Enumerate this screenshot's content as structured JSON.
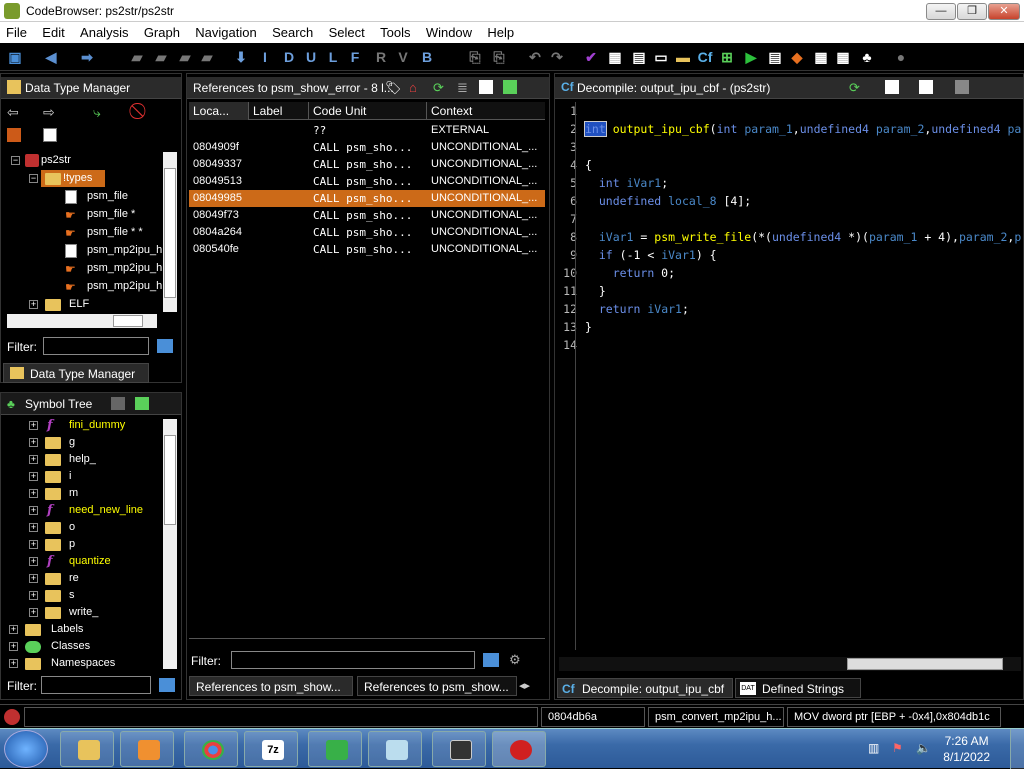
{
  "window": {
    "title": "CodeBrowser: ps2str/ps2str",
    "minimize": "—",
    "maximize": "❐",
    "close": "✕"
  },
  "menu": [
    "File",
    "Edit",
    "Analysis",
    "Graph",
    "Navigation",
    "Search",
    "Select",
    "Tools",
    "Window",
    "Help"
  ],
  "toolbar": {
    "letters": [
      "I",
      "D",
      "U",
      "L",
      "F",
      "V",
      "B"
    ]
  },
  "data_type_manager": {
    "title": "Data Type Manager",
    "tree": [
      {
        "label": "ps2str",
        "kind": "root"
      },
      {
        "label": "!types",
        "kind": "folder-open",
        "selected": true
      },
      {
        "label": "psm_file",
        "kind": "struct"
      },
      {
        "label": "psm_file *",
        "kind": "ptr"
      },
      {
        "label": "psm_file * *",
        "kind": "ptr"
      },
      {
        "label": "psm_mp2ipu_h",
        "kind": "struct"
      },
      {
        "label": "psm_mp2ipu_h",
        "kind": "ptr"
      },
      {
        "label": "psm_mp2ipu_h",
        "kind": "ptr"
      },
      {
        "label": "ELF",
        "kind": "folder"
      }
    ],
    "filter_label": "Filter:",
    "tab_label": "Data Type Manager"
  },
  "symbol_tree": {
    "title": "Symbol Tree",
    "items": [
      {
        "label": "fini_dummy",
        "kind": "func"
      },
      {
        "label": "g",
        "kind": "folder"
      },
      {
        "label": "help_",
        "kind": "folder"
      },
      {
        "label": "i",
        "kind": "folder"
      },
      {
        "label": "m",
        "kind": "folder"
      },
      {
        "label": "need_new_line",
        "kind": "func"
      },
      {
        "label": "o",
        "kind": "folder"
      },
      {
        "label": "p",
        "kind": "folder"
      },
      {
        "label": "quantize",
        "kind": "func"
      },
      {
        "label": "re",
        "kind": "folder"
      },
      {
        "label": "s",
        "kind": "folder"
      },
      {
        "label": "write_",
        "kind": "folder"
      },
      {
        "label": "Labels",
        "kind": "top"
      },
      {
        "label": "Classes",
        "kind": "top"
      },
      {
        "label": "Namespaces",
        "kind": "top"
      }
    ],
    "filter_label": "Filter:"
  },
  "references": {
    "title": "References to psm_show_error - 8 l...",
    "columns": [
      "Loca...",
      "Label",
      "Code Unit",
      "Context"
    ],
    "rows": [
      {
        "loc": "",
        "label": "",
        "code": "??",
        "ctx": "EXTERNAL",
        "selected": false
      },
      {
        "loc": "0804909f",
        "label": "",
        "code": "CALL psm_sho...",
        "ctx": "UNCONDITIONAL_...",
        "selected": false
      },
      {
        "loc": "08049337",
        "label": "",
        "code": "CALL psm_sho...",
        "ctx": "UNCONDITIONAL_...",
        "selected": false
      },
      {
        "loc": "08049513",
        "label": "",
        "code": "CALL psm_sho...",
        "ctx": "UNCONDITIONAL_...",
        "selected": false
      },
      {
        "loc": "08049985",
        "label": "",
        "code": "CALL psm_sho...",
        "ctx": "UNCONDITIONAL_...",
        "selected": true
      },
      {
        "loc": "08049f73",
        "label": "",
        "code": "CALL psm_sho...",
        "ctx": "UNCONDITIONAL_...",
        "selected": false
      },
      {
        "loc": "0804a264",
        "label": "",
        "code": "CALL psm_sho...",
        "ctx": "UNCONDITIONAL_...",
        "selected": false
      },
      {
        "loc": "080540fe",
        "label": "",
        "code": "CALL psm_sho...",
        "ctx": "UNCONDITIONAL_...",
        "selected": false
      }
    ],
    "filter_label": "Filter:",
    "tabs": [
      "References to psm_show...",
      "References to psm_show..."
    ]
  },
  "decompile": {
    "title": "Decompile: output_ipu_cbf -  (ps2str)",
    "line_numbers": [
      "1",
      "2",
      "3",
      "4",
      "5",
      "6",
      "7",
      "8",
      "9",
      "10",
      "11",
      "12",
      "13",
      "14"
    ],
    "tabs": [
      "Decompile: output_ipu_cbf",
      "Defined Strings"
    ]
  },
  "status": {
    "address": "0804db6a",
    "function": "psm_convert_mp2ipu_h...",
    "instruction": "MOV dword ptr [EBP + -0x4],0x804db1c"
  },
  "taskbar": {
    "time": "7:26 AM",
    "date": "8/1/2022"
  }
}
